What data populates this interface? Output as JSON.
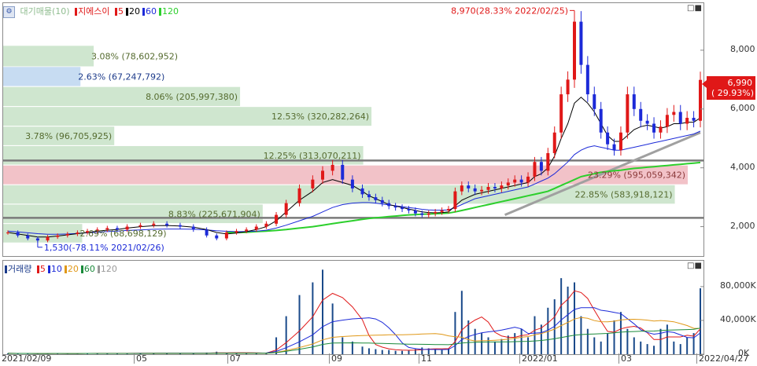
{
  "toolbar_icon": "settings-icon",
  "price_legend": {
    "main": "대기매물(10)",
    "ma_title": "지에스이",
    "ma": [
      {
        "label": "5",
        "color": "#e01818"
      },
      {
        "label": "20",
        "color": "#000000"
      },
      {
        "label": "60",
        "color": "#1c2ad8"
      },
      {
        "label": "120",
        "color": "#2ccf2c"
      }
    ]
  },
  "volume_legend": {
    "title": "거래량",
    "ma": [
      {
        "label": "5",
        "color": "#e01818"
      },
      {
        "label": "10",
        "color": "#1c2ad8"
      },
      {
        "label": "20",
        "color": "#e09818"
      },
      {
        "label": "60",
        "color": "#1a8a3a"
      },
      {
        "label": "120",
        "color": "#9a9a9a"
      }
    ]
  },
  "window_controls": [
    "□",
    "■"
  ],
  "chart_data": [
    {
      "type": "bar",
      "title": "대기매물(10)",
      "ylim": [
        1000,
        9600
      ],
      "y_ticks": [
        "2,000",
        "4,000",
        "6,000",
        "8,000"
      ],
      "y_tick_values": [
        2000,
        4000,
        6000,
        8000
      ],
      "x_ticks": [
        "2021/02/09",
        "05",
        "07",
        "09",
        "11",
        "2022/01",
        "03",
        "2022/04/27"
      ],
      "current_price": {
        "value": "6,990",
        "change": "( 29.93%)"
      },
      "max_annotation": "8,970(28.33% 2022/02/25)",
      "min_annotation": "1,530(-78.11% 2021/02/26)",
      "volume_profile": [
        {
          "label": "3.08% (78,602,952)",
          "pct": 3.08,
          "low": 7450,
          "high": 8150,
          "color": "#cfe6cf"
        },
        {
          "label": "2.63% (67,247,792)",
          "pct": 2.63,
          "low": 6780,
          "high": 7430,
          "color": "#c7dcf2"
        },
        {
          "label": "8.06% (205,997,380)",
          "pct": 8.06,
          "low": 6100,
          "high": 6750,
          "color": "#cfe6cf"
        },
        {
          "label": "12.53% (320,282,264)",
          "pct": 12.53,
          "low": 5430,
          "high": 6070,
          "color": "#cfe6cf"
        },
        {
          "label": "3.78% (96,705,925)",
          "pct": 3.78,
          "low": 4770,
          "high": 5400,
          "color": "#cfe6cf"
        },
        {
          "label": "12.25% (313,070,211)",
          "pct": 12.25,
          "low": 4110,
          "high": 4740,
          "color": "#cfe6cf"
        },
        {
          "label": "23.29% (595,059,342)",
          "pct": 23.29,
          "low": 3440,
          "high": 4080,
          "color": "#f2c2c8"
        },
        {
          "label": "22.85% (583,918,121)",
          "pct": 22.85,
          "low": 2780,
          "high": 3410,
          "color": "#cfe6cf"
        },
        {
          "label": "8.83% (225,671,904)",
          "pct": 8.83,
          "low": 2120,
          "high": 2750,
          "color": "#cfe6cf"
        },
        {
          "label": "2.69% (68,698,129)",
          "pct": 2.69,
          "low": 1460,
          "high": 2090,
          "color": "#cfe6cf"
        }
      ],
      "support_lines": [
        4250,
        2300
      ],
      "price_series": {
        "x": [
          0,
          6,
          12,
          18,
          24,
          30,
          36,
          42,
          48,
          54,
          60,
          66,
          72,
          80,
          88,
          96,
          104,
          112,
          120,
          126,
          132,
          138,
          144,
          150,
          156,
          162,
          168,
          176,
          184,
          190,
          196,
          202,
          208,
          214,
          218,
          222,
          226,
          230,
          234,
          238,
          242,
          246,
          250,
          254,
          258,
          262,
          266,
          270,
          274,
          278,
          282,
          286,
          290,
          294,
          298,
          302,
          306,
          310,
          314,
          318,
          322,
          326,
          330,
          334,
          338,
          342,
          346,
          350,
          354,
          358,
          362,
          366,
          370,
          374,
          378,
          382,
          386,
          390,
          394,
          398,
          402,
          406,
          410,
          414,
          418
        ],
        "close": [
          1800,
          1700,
          1600,
          1530,
          1650,
          1700,
          1750,
          1800,
          1850,
          1900,
          1950,
          1900,
          2000,
          2050,
          2100,
          2050,
          2000,
          1900,
          1700,
          1600,
          1800,
          1850,
          1900,
          2000,
          2100,
          2400,
          2800,
          3300,
          3600,
          3900,
          4100,
          3600,
          3300,
          3100,
          3000,
          2900,
          2800,
          2700,
          2650,
          2600,
          2550,
          2450,
          2400,
          2450,
          2500,
          2550,
          2600,
          3200,
          3400,
          3300,
          3200,
          3250,
          3350,
          3300,
          3400,
          3500,
          3600,
          3500,
          3700,
          4200,
          3900,
          4500,
          5200,
          6500,
          7000,
          8970,
          7500,
          6500,
          6000,
          5200,
          4800,
          4600,
          5200,
          6500,
          6000,
          5600,
          5500,
          5200,
          5400,
          5800,
          5900,
          5500,
          5700,
          5600,
          6990
        ]
      },
      "ma_series": {
        "ma20": [
          1800,
          1750,
          1700,
          1650,
          1650,
          1680,
          1720,
          1760,
          1800,
          1850,
          1880,
          1900,
          1950,
          2000,
          2030,
          2040,
          2020,
          1980,
          1900,
          1800,
          1750,
          1780,
          1830,
          1900,
          2000,
          2200,
          2500,
          2900,
          3200,
          3500,
          3600,
          3500,
          3400,
          3200,
          3050,
          2950,
          2850,
          2750,
          2700,
          2650,
          2600,
          2550,
          2500,
          2480,
          2470,
          2480,
          2500,
          2700,
          2900,
          3000,
          3100,
          3150,
          3200,
          3250,
          3300,
          3350,
          3400,
          3450,
          3500,
          3700,
          3800,
          4000,
          4400,
          5000,
          5500,
          6200,
          6400,
          6200,
          5900,
          5500,
          5100,
          4900,
          4900,
          5100,
          5300,
          5400,
          5450,
          5400,
          5350,
          5400,
          5500,
          5500,
          5550,
          5550,
          5700
        ],
        "ma60": [
          1850,
          1820,
          1790,
          1760,
          1740,
          1740,
          1750,
          1770,
          1790,
          1810,
          1830,
          1850,
          1870,
          1890,
          1910,
          1920,
          1920,
          1910,
          1890,
          1860,
          1840,
          1830,
          1830,
          1850,
          1880,
          1950,
          2050,
          2200,
          2350,
          2500,
          2650,
          2750,
          2800,
          2820,
          2820,
          2800,
          2770,
          2740,
          2710,
          2680,
          2650,
          2620,
          2590,
          2570,
          2560,
          2560,
          2570,
          2650,
          2750,
          2850,
          2950,
          3000,
          3050,
          3100,
          3150,
          3200,
          3250,
          3300,
          3350,
          3450,
          3550,
          3650,
          3800,
          4000,
          4200,
          4450,
          4600,
          4700,
          4750,
          4700,
          4650,
          4600,
          4600,
          4650,
          4700,
          4750,
          4800,
          4850,
          4900,
          4950,
          5000,
          5050,
          5100,
          5150,
          5250
        ],
        "ma120": [
          null,
          null,
          null,
          null,
          null,
          null,
          null,
          null,
          null,
          null,
          null,
          null,
          null,
          null,
          null,
          null,
          null,
          null,
          null,
          null,
          1800,
          1800,
          1810,
          1830,
          1850,
          1870,
          1900,
          1950,
          2000,
          2050,
          2100,
          2150,
          2200,
          2250,
          2280,
          2300,
          2320,
          2340,
          2360,
          2380,
          2400,
          2410,
          2420,
          2430,
          2440,
          2450,
          2460,
          2500,
          2550,
          2600,
          2650,
          2700,
          2750,
          2800,
          2850,
          2900,
          2950,
          3000,
          3050,
          3100,
          3150,
          3200,
          3300,
          3400,
          3500,
          3600,
          3700,
          3750,
          3800,
          3850,
          3880,
          3900,
          3920,
          3950,
          3980,
          4000,
          4020,
          4040,
          4060,
          4080,
          4100,
          4120,
          4140,
          4160,
          4180
        ]
      }
    },
    {
      "type": "bar",
      "title": "거래량",
      "ylim": [
        0,
        105000
      ],
      "y_ticks": [
        "80,000K",
        "40,000K",
        "0K"
      ],
      "y_tick_values": [
        80000,
        40000,
        0
      ],
      "volumes": [
        1000,
        800,
        900,
        700,
        900,
        1000,
        800,
        900,
        1000,
        1200,
        1100,
        900,
        1000,
        1200,
        1400,
        1200,
        1000,
        900,
        2000,
        3000,
        1500,
        1200,
        1000,
        1200,
        1500,
        20000,
        45000,
        70000,
        85000,
        100000,
        60000,
        20000,
        15000,
        9000,
        7000,
        6000,
        5000,
        5000,
        4000,
        4000,
        5000,
        6000,
        8000,
        7000,
        6000,
        5000,
        7000,
        50000,
        75000,
        40000,
        30000,
        25000,
        20000,
        15000,
        18000,
        22000,
        25000,
        30000,
        20000,
        45000,
        35000,
        55000,
        65000,
        90000,
        80000,
        85000,
        45000,
        30000,
        20000,
        15000,
        25000,
        40000,
        50000,
        30000,
        20000,
        15000,
        12000,
        10000,
        30000,
        35000,
        15000,
        12000,
        20000,
        25000,
        78000
      ]
    }
  ]
}
